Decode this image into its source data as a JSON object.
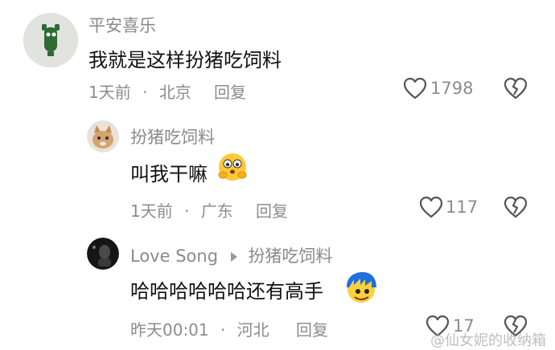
{
  "comments": [
    {
      "username": "平安喜乐",
      "text": "我就是这样扮猪吃饲料",
      "time": "1天前",
      "location": "北京",
      "reply_label": "回复",
      "likes": "1798"
    },
    {
      "username": "扮猪吃饲料",
      "text": "叫我干嘛",
      "time": "1天前",
      "location": "广东",
      "reply_label": "回复",
      "likes": "117"
    },
    {
      "username": "Love Song",
      "reply_to": "扮猪吃饲料",
      "text": "哈哈哈哈哈哈还有高手",
      "time": "昨天00:01",
      "location": "河北",
      "reply_label": "回复",
      "likes": "17"
    }
  ],
  "separator": "·",
  "watermark": "@仙女妮的收纳箱",
  "colors": {
    "meta_gray": "#8c8c8c",
    "text": "#111111",
    "background": "#ffffff"
  },
  "icons": {
    "like": "heart-outline-icon",
    "dislike": "broken-heart-icon",
    "reply_arrow": "triangle-right-icon",
    "emoji_1": "shy-face-emoji-icon",
    "emoji_2": "blue-hair-face-emoji-icon"
  }
}
